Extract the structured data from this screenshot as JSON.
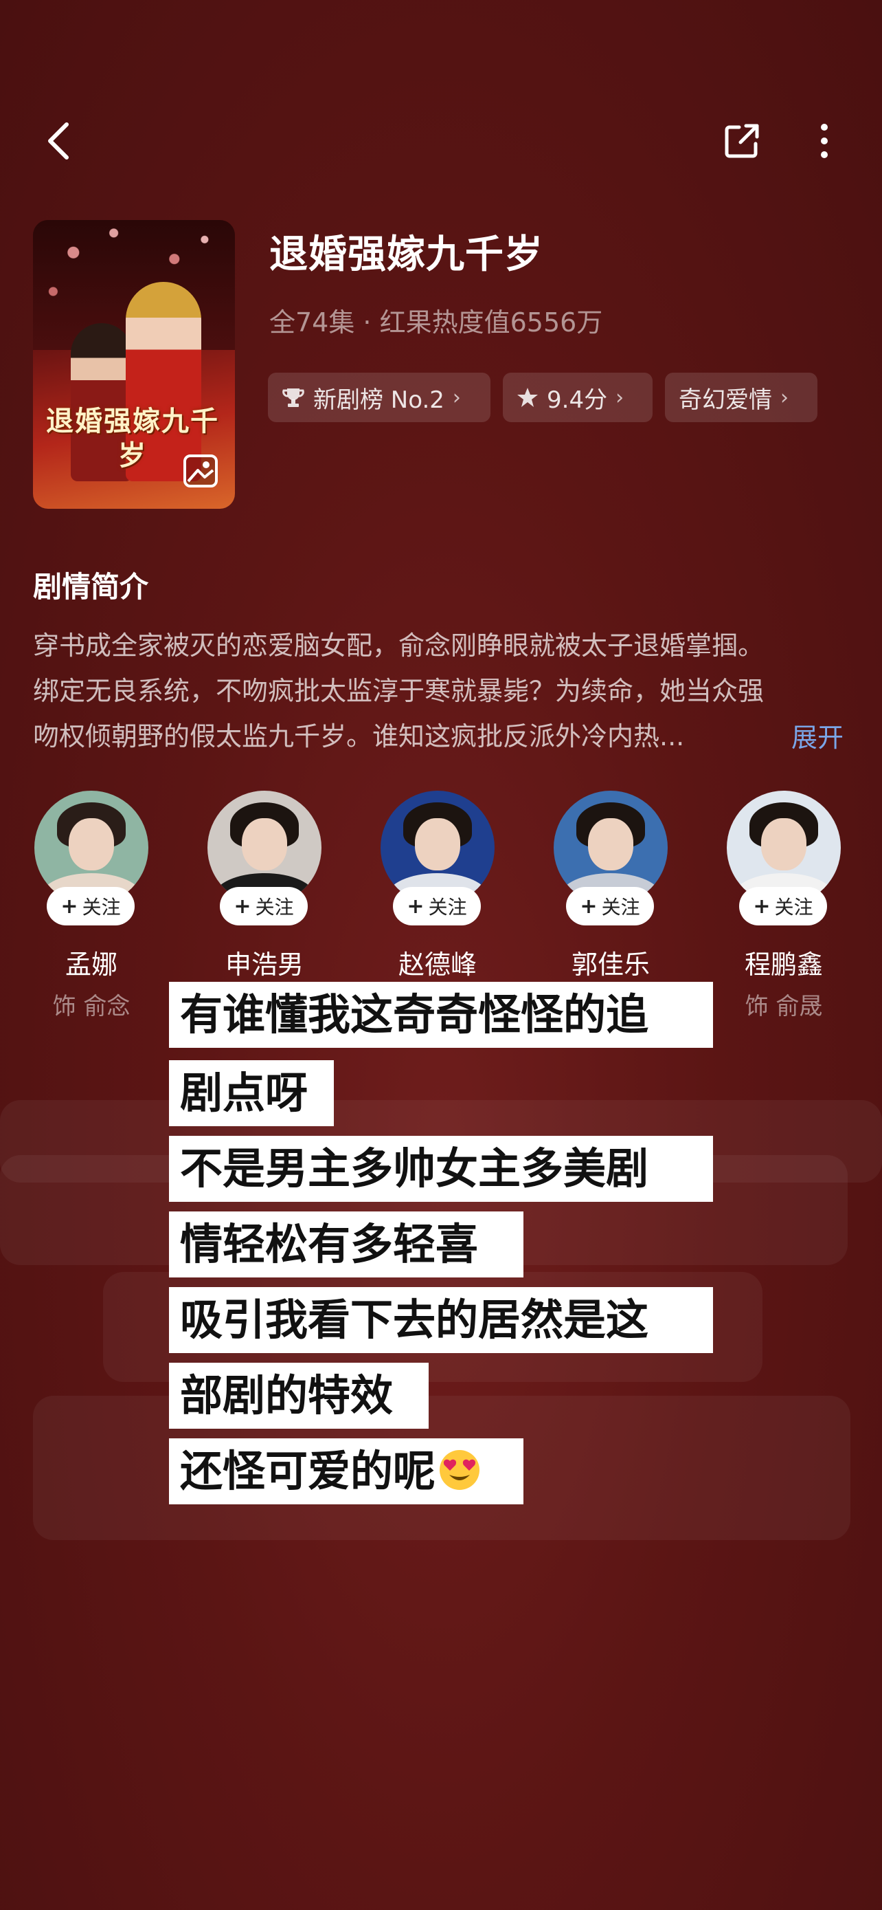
{
  "header": {
    "back_icon": "chevron-left-icon",
    "share_icon": "share-icon",
    "more_icon": "more-vertical-icon"
  },
  "drama": {
    "poster_title": "退婚强嫁九千岁",
    "title": "退婚强嫁九千岁",
    "meta": "全74集 · 红果热度值6556万",
    "tags": [
      {
        "icon": "trophy-icon",
        "label": "新剧榜 No.2"
      },
      {
        "icon": "star-icon",
        "label": "9.4分"
      },
      {
        "icon": "",
        "label": "奇幻爱情"
      }
    ]
  },
  "synopsis": {
    "title": "剧情简介",
    "lines": [
      "穿书成全家被灭的恋爱脑女配，俞念刚睁眼就被太子退婚掌掴。",
      "绑定无良系统，不吻疯批太监淳于寒就暴毙？为续命，她当众强",
      "吻权倾朝野的假太监九千岁。谁知这疯批反派外冷内热..."
    ],
    "expand_label": "展开"
  },
  "cast": {
    "follow_label": "关注",
    "members": [
      {
        "name": "孟娜",
        "role": "饰 俞念"
      },
      {
        "name": "申浩男",
        "role": ""
      },
      {
        "name": "赵德峰",
        "role": ""
      },
      {
        "name": "郭佳乐",
        "role": ""
      },
      {
        "name": "程鹏鑫",
        "role": "饰 俞晟"
      }
    ]
  },
  "caption": {
    "lines": [
      "有谁懂我这奇奇怪怪的追",
      "剧点呀",
      "不是男主多帅女主多美剧",
      "情轻松有多轻喜",
      "吸引我看下去的居然是这",
      "部剧的特效",
      "还怪可爱的呢"
    ],
    "emoji": "heart-eyes-emoji"
  },
  "colors": {
    "background": "#5b1514",
    "expand_link": "#7aa6e8",
    "caption_bg": "#ffffff"
  }
}
